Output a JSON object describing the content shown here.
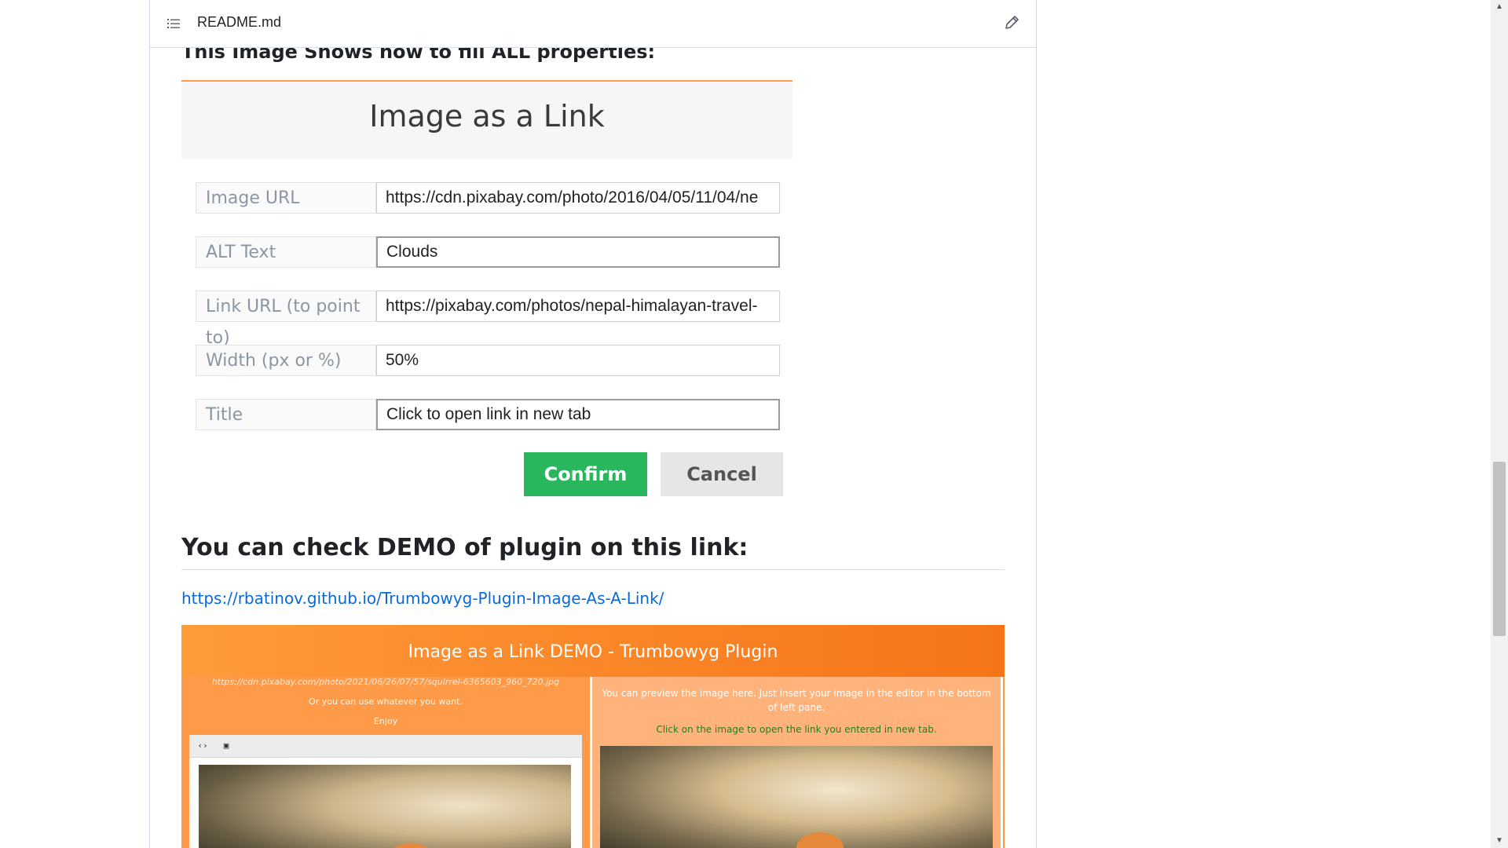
{
  "header": {
    "file_name": "README.md",
    "icons": {
      "toc": "list-icon",
      "edit": "pencil-icon"
    }
  },
  "content": {
    "props_heading": "This Image Shows how to fill ALL properties:",
    "dialog": {
      "title": "Image as a Link",
      "rows": [
        {
          "label": "Image URL",
          "value": "https://cdn.pixabay.com/photo/2016/04/05/11/04/ne"
        },
        {
          "label": "ALT Text",
          "value": "Clouds"
        },
        {
          "label": "Link URL (to point to)",
          "value": "https://pixabay.com/photos/nepal-himalayan-travel-"
        },
        {
          "label": "Width (px or %)",
          "value": "50%"
        },
        {
          "label": "Title",
          "value": "Click to open link in new tab"
        }
      ],
      "confirm_label": "Confirm",
      "cancel_label": "Cancel",
      "colors": {
        "confirm": "#2ab65c",
        "cancel": "#e6e6e6"
      }
    },
    "demo_heading": "You can check DEMO of plugin on this link:",
    "demo_link": "https://rbatinov.github.io/Trumbowyg-Plugin-Image-As-A-Link/",
    "demo": {
      "banner": "Image as a Link DEMO - Trumbowyg Plugin",
      "left_url": "https://cdn.pixabay.com/photo/2021/06/26/07/57/squirrel-6365603_960_720.jpg",
      "left_line2": "Or you can use whatever you want.",
      "left_line3": "Enjoy",
      "toolbar_code": "‹›",
      "toolbar_image": "▣",
      "right_line1": "You can preview the image here. Just insert your image in the editor in the bottom of left pane.",
      "right_line2": "Click on the image to open the link you entered in new tab.",
      "colors": {
        "banner_start": "#ff9b3a",
        "banner_end": "#f57418",
        "green_text": "#2a7a1c"
      }
    }
  },
  "scrollbar": {
    "up": "▲",
    "down": "▼"
  }
}
